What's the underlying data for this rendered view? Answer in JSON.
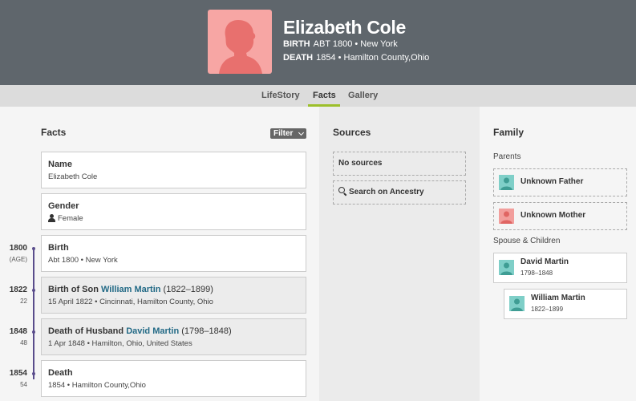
{
  "person": {
    "name": "Elizabeth Cole",
    "birth_label": "BIRTH",
    "birth_value": "ABT 1800 • New York",
    "death_label": "DEATH",
    "death_value": "1854 • Hamilton County,Ohio"
  },
  "tabs": [
    {
      "label": "LifeStory"
    },
    {
      "label": "Facts",
      "active": true
    },
    {
      "label": "Gallery"
    }
  ],
  "facts": {
    "title": "Facts",
    "filter_label": "Filter",
    "cards": [
      {
        "title": "Name",
        "detail": "Elizabeth Cole"
      },
      {
        "title": "Gender",
        "detail": "Female"
      },
      {
        "title": "Birth",
        "detail": "Abt 1800 • New York",
        "year": "1800",
        "age": "(AGE)"
      },
      {
        "title_prefix": "Birth of Son",
        "link": "William Martin",
        "years": "(1822–1899)",
        "detail": "15 April 1822 • Cincinnati, Hamilton County, Ohio",
        "year": "1822",
        "age": "22"
      },
      {
        "title_prefix": "Death of Husband",
        "link": "David Martin",
        "years": "(1798–1848)",
        "detail": "1 Apr 1848 • Hamilton, Ohio, United States",
        "year": "1848",
        "age": "48"
      },
      {
        "title": "Death",
        "detail": "1854 • Hamilton County,Ohio",
        "year": "1854",
        "age": "54"
      }
    ]
  },
  "sources": {
    "title": "Sources",
    "no_sources": "No sources",
    "search_label": "Search on Ancestry"
  },
  "family": {
    "title": "Family",
    "parents_label": "Parents",
    "father": "Unknown Father",
    "mother": "Unknown Mother",
    "spouse_label": "Spouse & Children",
    "spouse": {
      "name": "David Martin",
      "years": "1798–1848"
    },
    "child": {
      "name": "William Martin",
      "years": "1822–1899"
    }
  },
  "colors": {
    "header_bg": "#5f666c",
    "accent_green": "#9cbf2a",
    "link_blue": "#236a86",
    "timeline_purple": "#5a4d8c",
    "female_pink": "#f7a6a4",
    "male_teal": "#7fcfc8"
  }
}
